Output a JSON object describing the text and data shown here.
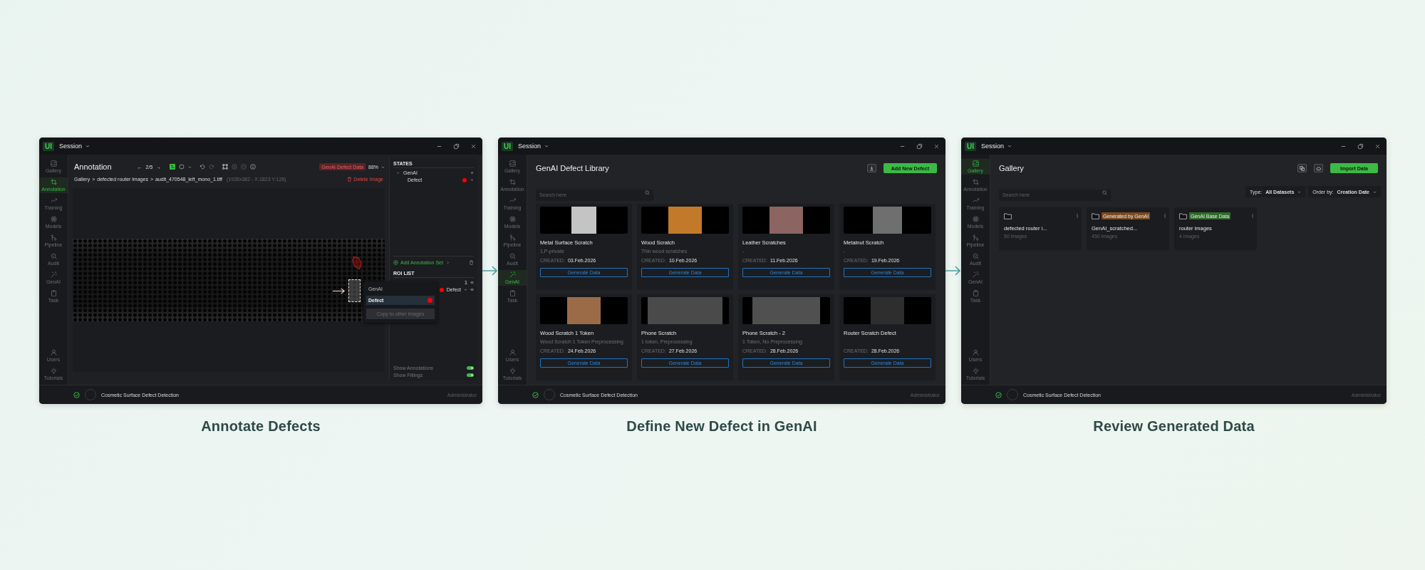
{
  "screens": [
    {
      "kind": "annotation",
      "caption": "Annotate Defects",
      "title_bar": {
        "logo": "UI",
        "title": "Session"
      },
      "nav": {
        "top": [
          {
            "label": "Gallery",
            "selected": false
          },
          {
            "label": "Annotation",
            "selected": true
          },
          {
            "label": "Training",
            "selected": false
          },
          {
            "label": "Models",
            "selected": false
          },
          {
            "label": "Pipeline",
            "selected": false
          },
          {
            "label": "Audit",
            "selected": false
          },
          {
            "label": "GenAI",
            "selected": false
          },
          {
            "label": "Task",
            "selected": false
          }
        ],
        "bottom": [
          {
            "label": "Users",
            "selected": false
          },
          {
            "label": "Tutorials",
            "selected": false
          }
        ]
      },
      "header": {
        "title": "Annotation",
        "prev": "←",
        "page": "2/5",
        "next": "→",
        "badge": "GenAI Defect Data",
        "zoom": "88%"
      },
      "breadcrumb": {
        "separator": ">",
        "items": [
          "Gallery",
          "defected router images",
          "audit_470548_left_mono_1.tiff"
        ],
        "info": "(1935x382 - X:1823 Y:128)"
      },
      "delete": "Delete Image",
      "states": {
        "title": "STATES",
        "groups": [
          {
            "label": "GenAI",
            "expanded": true,
            "children": [
              {
                "label": "Defect",
                "color": "#ff0000"
              }
            ]
          }
        ]
      },
      "add_set": "Add Annotation Set",
      "roi": {
        "title": "ROI LIST",
        "count": "1",
        "label": "Defect",
        "color": "#ff0000"
      },
      "popup": {
        "items": [
          {
            "label": "GenAI",
            "selected": false
          },
          {
            "label": "Defect",
            "selected": true,
            "color": "#ff0000"
          }
        ],
        "action": {
          "label": "Copy to other images",
          "disabled": true
        }
      },
      "toggles": [
        {
          "label": "Show Annotations",
          "on": true
        },
        {
          "label": "Show Fillings",
          "on": true
        }
      ],
      "footer": {
        "project": "Cosmetic Surface Defect Detection",
        "user": "Administrator"
      }
    },
    {
      "kind": "library",
      "caption": "Define New Defect in GenAI",
      "title_bar": {
        "logo": "UI",
        "title": "Session"
      },
      "nav": {
        "top": [
          {
            "label": "Gallery",
            "selected": false
          },
          {
            "label": "Annotation",
            "selected": false
          },
          {
            "label": "Training",
            "selected": false
          },
          {
            "label": "Models",
            "selected": false
          },
          {
            "label": "Pipeline",
            "selected": false
          },
          {
            "label": "Audit",
            "selected": false
          },
          {
            "label": "GenAI",
            "selected": true
          },
          {
            "label": "Task",
            "selected": false
          }
        ],
        "bottom": [
          {
            "label": "Users",
            "selected": false
          },
          {
            "label": "Tutorials",
            "selected": false
          }
        ]
      },
      "title": "GenAI Defect Library",
      "add_button": "Add New Defect",
      "search": {
        "placeholder": "Search here"
      },
      "cards": [
        {
          "title": "Metal Surface Scratch",
          "description": "1,P-private",
          "created_label": "CREATED:",
          "created": "03.Feb.2026",
          "action": "Generate Data"
        },
        {
          "title": "Wood Scratch",
          "description": "Thin wood scratches",
          "created_label": "CREATED:",
          "created": "10.Feb.2026",
          "action": "Generate Data"
        },
        {
          "title": "Leather Scratches",
          "description": "-",
          "created_label": "CREATED:",
          "created": "11.Feb.2026",
          "action": "Generate Data"
        },
        {
          "title": "Metalnut Scratch",
          "description": "-",
          "created_label": "CREATED:",
          "created": "19.Feb.2026",
          "action": "Generate Data"
        },
        {
          "title": "Wood Scratch 1 Token",
          "description": "Wood Scratch 1 Token Preprocessing",
          "created_label": "CREATED:",
          "created": "24.Feb.2026",
          "action": "Generate Data"
        },
        {
          "title": "Phone Scratch",
          "description": "1 token, Preprocessing",
          "created_label": "CREATED:",
          "created": "27.Feb.2026",
          "action": "Generate Data"
        },
        {
          "title": "Phone Scratch - 2",
          "description": "1 Token, No Preprocessing",
          "created_label": "CREATED:",
          "created": "28.Feb.2026",
          "action": "Generate Data"
        },
        {
          "title": "Router Scratch Defect",
          "created_label": "CREATED:",
          "created": "28.Feb.2026",
          "action": "Generate Data"
        }
      ],
      "footer": {
        "project": "Cosmetic Surface Defect Detection",
        "user": "Administrator"
      }
    },
    {
      "kind": "gallery",
      "caption": "Review Generated Data",
      "title_bar": {
        "logo": "UI",
        "title": "Session"
      },
      "nav": {
        "top": [
          {
            "label": "Gallery",
            "selected": true
          },
          {
            "label": "Annotation",
            "selected": false
          },
          {
            "label": "Training",
            "selected": false
          },
          {
            "label": "Models",
            "selected": false
          },
          {
            "label": "Pipeline",
            "selected": false
          },
          {
            "label": "Audit",
            "selected": false
          },
          {
            "label": "GenAI",
            "selected": false
          },
          {
            "label": "Task",
            "selected": false
          }
        ],
        "bottom": [
          {
            "label": "Users",
            "selected": false
          },
          {
            "label": "Tutorials",
            "selected": false
          }
        ]
      },
      "title": "Gallery",
      "import_button": "Import Data",
      "search": {
        "placeholder": "Search here"
      },
      "filters": [
        {
          "label": "Type:",
          "value": "All Datasets"
        },
        {
          "label": "Order by:",
          "value": "Creation Date"
        }
      ],
      "folders": [
        {
          "name": "defected router i...",
          "count": "50 images"
        },
        {
          "name": "GenAI_scratched...",
          "count": "450 images",
          "badge": {
            "text": "Generated by GenAI",
            "color": "#7a4a22"
          }
        },
        {
          "name": "router images",
          "count": "4 images",
          "badge": {
            "text": "GenAI Base Data",
            "color": "#2f6b2c"
          }
        }
      ],
      "footer": {
        "project": "Cosmetic Surface Defect Detection",
        "user": "Administrator"
      }
    }
  ]
}
